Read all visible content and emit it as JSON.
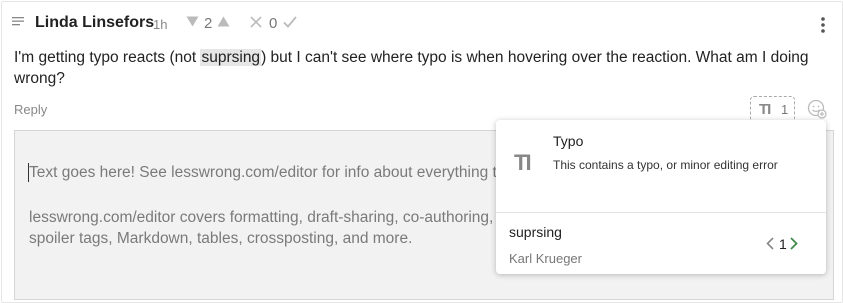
{
  "comment": {
    "author": "Linda Linsefors",
    "time": "1h",
    "karma": "2",
    "agreement": "0",
    "text_before": "I'm getting typo reacts (not ",
    "highlight": "suprsing",
    "text_after": ") but I can't see where typo is when hovering over the reaction. What am I doing wrong?",
    "reply_label": "Reply"
  },
  "reaction": {
    "glyph": "TI",
    "count": "1"
  },
  "editor": {
    "placeholder_line1": "Text goes here! See lesswrong.com/editor for info about everything th",
    "placeholder_line2": "lesswrong.com/editor covers formatting, draft-sharing, co-authoring, L spoiler tags, Markdown, tables, crossposting, and more."
  },
  "popup": {
    "glyph": "TI",
    "title": "Typo",
    "description": "This contains a typo, or minor editing error",
    "quote": "suprsing",
    "user": "Karl Krueger",
    "page": "1"
  },
  "icons": {
    "collapse": "collapse-lines-icon",
    "vote_down": "triangle-down-icon",
    "vote_up": "triangle-up-icon",
    "disagree": "x-icon",
    "agree": "check-icon",
    "menu": "vertical-dots-icon",
    "add_reaction": "add-reaction-icon",
    "prev": "chevron-left-icon",
    "next": "chevron-right-icon"
  },
  "colors": {
    "highlight_bg": "#e6e6e6",
    "pager_next": "#3f8a4a"
  }
}
